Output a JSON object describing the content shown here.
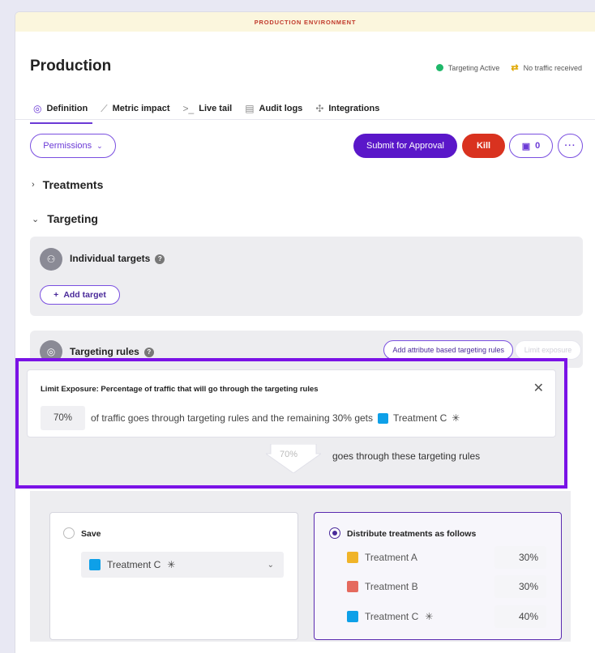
{
  "banner": "PRODUCTION ENVIRONMENT",
  "page_title": "Production",
  "status": {
    "targeting": "Targeting Active",
    "traffic": "No traffic received",
    "active_color": "#1fb86a"
  },
  "tabs": [
    {
      "label": "Definition",
      "icon": "definition-icon"
    },
    {
      "label": "Metric impact",
      "icon": "chart-line-icon"
    },
    {
      "label": "Live tail",
      "icon": "terminal-icon"
    },
    {
      "label": "Audit logs",
      "icon": "document-search-icon"
    },
    {
      "label": "Integrations",
      "icon": "puzzle-icon"
    }
  ],
  "toolbar": {
    "permissions": "Permissions",
    "submit": "Submit for Approval",
    "kill": "Kill",
    "calendar_count": "0"
  },
  "sections": {
    "treatments": "Treatments",
    "targeting": "Targeting"
  },
  "individual_targets": {
    "title": "Individual targets",
    "add": "Add target"
  },
  "targeting_rules": {
    "title": "Targeting rules",
    "attr_button": "Add attribute based targeting rules",
    "limit_button": "Limit exposure"
  },
  "limit": {
    "title": "Limit Exposure: Percentage of traffic that will go through the targeting rules",
    "percent": "70%",
    "text": "of traffic goes through targeting rules and the remaining 30% gets",
    "treatment": "Treatment C",
    "arrow_pct": "70%",
    "goes_text": "goes through these targeting rules"
  },
  "serve": {
    "label": "Save",
    "selected": "Treatment C"
  },
  "distribute": {
    "label": "Distribute treatments as follows",
    "rows": [
      {
        "name": "Treatment A",
        "pct": "30%",
        "color": "#f0b429"
      },
      {
        "name": "Treatment B",
        "pct": "30%",
        "color": "#e56a5e"
      },
      {
        "name": "Treatment C",
        "pct": "40%",
        "color": "#0ea0e8"
      }
    ]
  },
  "colors": {
    "accent": "#6b3ad6",
    "approve": "#5a17c9",
    "kill": "#d9321f",
    "highlight": "#7a12e6",
    "treatment_c": "#0ea0e8"
  }
}
